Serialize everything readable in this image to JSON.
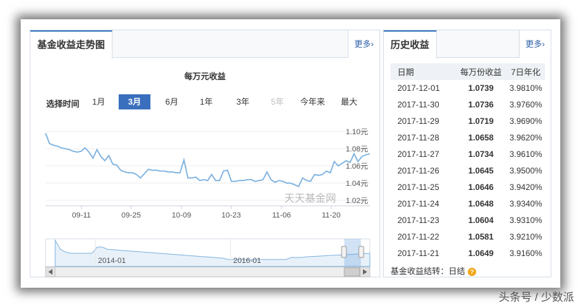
{
  "left_panel": {
    "title": "基金收益走势图",
    "more": "更多›",
    "chart_title": "每万元收益",
    "period_label": "选择时间",
    "periods": [
      "1月",
      "3月",
      "6月",
      "1年",
      "3年",
      "5年",
      "今年来",
      "最大"
    ],
    "active_period": "3月",
    "disabled_period": "5年",
    "watermark": "天天基金网"
  },
  "chart_data": {
    "type": "line",
    "title": "每万元收益",
    "y_ticks": [
      "1.10元",
      "1.08元",
      "1.06元",
      "1.04元",
      "1.02元"
    ],
    "ylim": [
      1.02,
      1.1
    ],
    "x_ticks": [
      "09-11",
      "09-25",
      "10-09",
      "10-23",
      "11-06",
      "11-20"
    ],
    "series": [
      {
        "color": "#7fb3e0",
        "values": [
          1.098,
          1.086,
          1.084,
          1.083,
          1.081,
          1.08,
          1.079,
          1.077,
          1.076,
          1.077,
          1.081,
          1.076,
          1.069,
          1.079,
          1.071,
          1.066,
          1.072,
          1.062,
          1.061,
          1.055,
          1.053,
          1.052,
          1.052,
          1.05,
          1.046,
          1.051,
          1.056,
          1.055,
          1.055,
          1.054,
          1.054,
          1.053,
          1.053,
          1.052,
          1.052,
          1.067,
          1.046,
          1.046,
          1.047,
          1.043,
          1.044,
          1.043,
          1.05,
          1.043,
          1.043,
          1.054,
          1.055,
          1.042,
          1.042,
          1.043,
          1.043,
          1.044,
          1.044,
          1.042,
          1.043,
          1.044,
          1.053,
          1.044,
          1.041,
          1.043,
          1.042,
          1.04,
          1.04,
          1.038,
          1.036,
          1.046,
          1.043,
          1.042,
          1.05,
          1.049,
          1.05,
          1.054,
          1.052,
          1.065,
          1.06,
          1.063,
          1.066,
          1.064,
          1.074,
          1.065,
          1.071,
          1.073,
          1.074
        ]
      }
    ],
    "navigator_labels": [
      "2014-01",
      "2016-01"
    ]
  },
  "right_panel": {
    "title": "历史收益",
    "more": "更多›",
    "columns": [
      "日期",
      "每万份收益",
      "7日年化"
    ],
    "rows": [
      [
        "2017-12-01",
        "1.0739",
        "3.9810%"
      ],
      [
        "2017-11-30",
        "1.0736",
        "3.9760%"
      ],
      [
        "2017-11-29",
        "1.0719",
        "3.9690%"
      ],
      [
        "2017-11-28",
        "1.0658",
        "3.9620%"
      ],
      [
        "2017-11-27",
        "1.0734",
        "3.9610%"
      ],
      [
        "2017-11-26",
        "1.0645",
        "3.9500%"
      ],
      [
        "2017-11-25",
        "1.0646",
        "3.9420%"
      ],
      [
        "2017-11-24",
        "1.0648",
        "3.9340%"
      ],
      [
        "2017-11-23",
        "1.0604",
        "3.9310%"
      ],
      [
        "2017-11-22",
        "1.0581",
        "3.9210%"
      ],
      [
        "2017-11-21",
        "1.0649",
        "3.9160%"
      ]
    ],
    "settle_label": "基金收益结转：",
    "settle_value": "日结",
    "settle_icon": "question-icon"
  },
  "footer": "头条号 / 少数派"
}
